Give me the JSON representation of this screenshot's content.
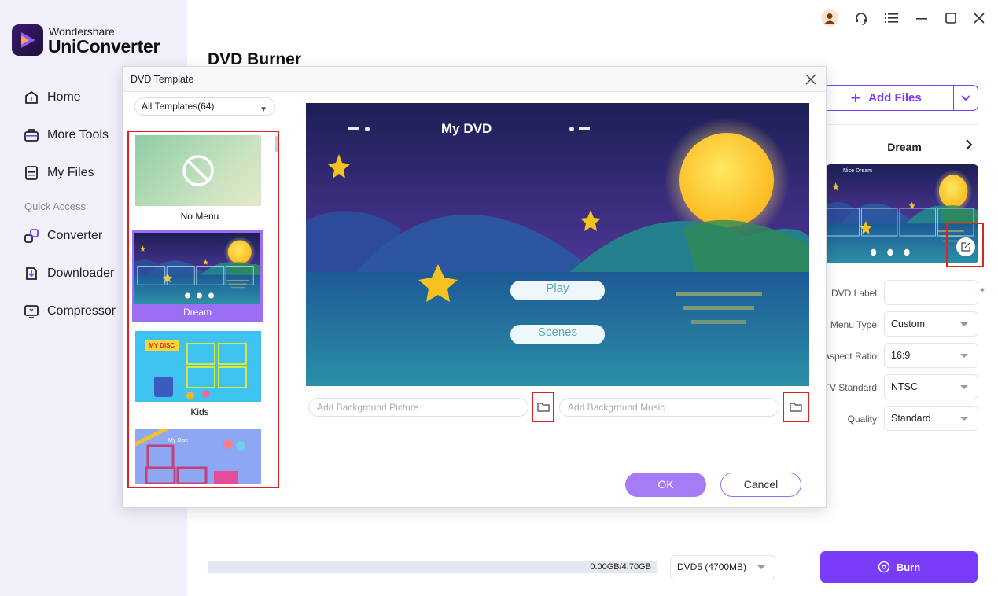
{
  "app": {
    "brand_top": "Wondershare",
    "brand_name": "UniConverter",
    "page_title": "DVD Burner"
  },
  "sidebar": {
    "items": [
      {
        "label": "Home",
        "icon": "home-icon"
      },
      {
        "label": "More Tools",
        "icon": "toolbox-icon"
      },
      {
        "label": "My Files",
        "icon": "file-icon"
      }
    ],
    "section_label": "Quick Access",
    "quick": [
      {
        "label": "Converter",
        "icon": "converter-icon"
      },
      {
        "label": "Downloader",
        "icon": "downloader-icon"
      },
      {
        "label": "Compressor",
        "icon": "compressor-icon"
      }
    ]
  },
  "window": {
    "icons": [
      "avatar-icon",
      "headset-icon",
      "menu-icon",
      "minimize-icon",
      "maximize-icon",
      "close-icon"
    ]
  },
  "right_panel": {
    "add_files": "Add Files",
    "template_name": "Dream",
    "thumb_title": "Nice Dream",
    "fields": [
      {
        "label": "DVD Label",
        "value": ""
      },
      {
        "label": "Menu Type",
        "value": "Custom"
      },
      {
        "label": "Aspect Ratio",
        "value": "16:9"
      },
      {
        "label": "TV Standard",
        "value": "NTSC"
      },
      {
        "label": "Quality",
        "value": "Standard"
      }
    ],
    "required_mark": "*"
  },
  "bottom": {
    "usage": "0.00GB/4.70GB",
    "usage_fraction": 0,
    "disc_type": "DVD5 (4700MB)",
    "burn": "Burn"
  },
  "dialog": {
    "title": "DVD Template",
    "filter": "All Templates(64)",
    "templates": [
      {
        "label": "No Menu"
      },
      {
        "label": "Dream",
        "selected": true
      },
      {
        "label": "Kids",
        "thumb_text": "MY DISC"
      },
      {
        "label": "",
        "thumb_text": "My Disc"
      }
    ],
    "preview": {
      "title": "My DVD",
      "buttons": [
        "Play",
        "Scenes"
      ]
    },
    "bg_picture_placeholder": "Add Background Picture",
    "bg_music_placeholder": "Add Background Music",
    "ok": "OK",
    "cancel": "Cancel"
  },
  "colors": {
    "accent": "#7b3cf9",
    "accent_light": "#a57cf6",
    "highlight_box": "#dd2222",
    "sidebar_bg": "#f2f0fa"
  }
}
